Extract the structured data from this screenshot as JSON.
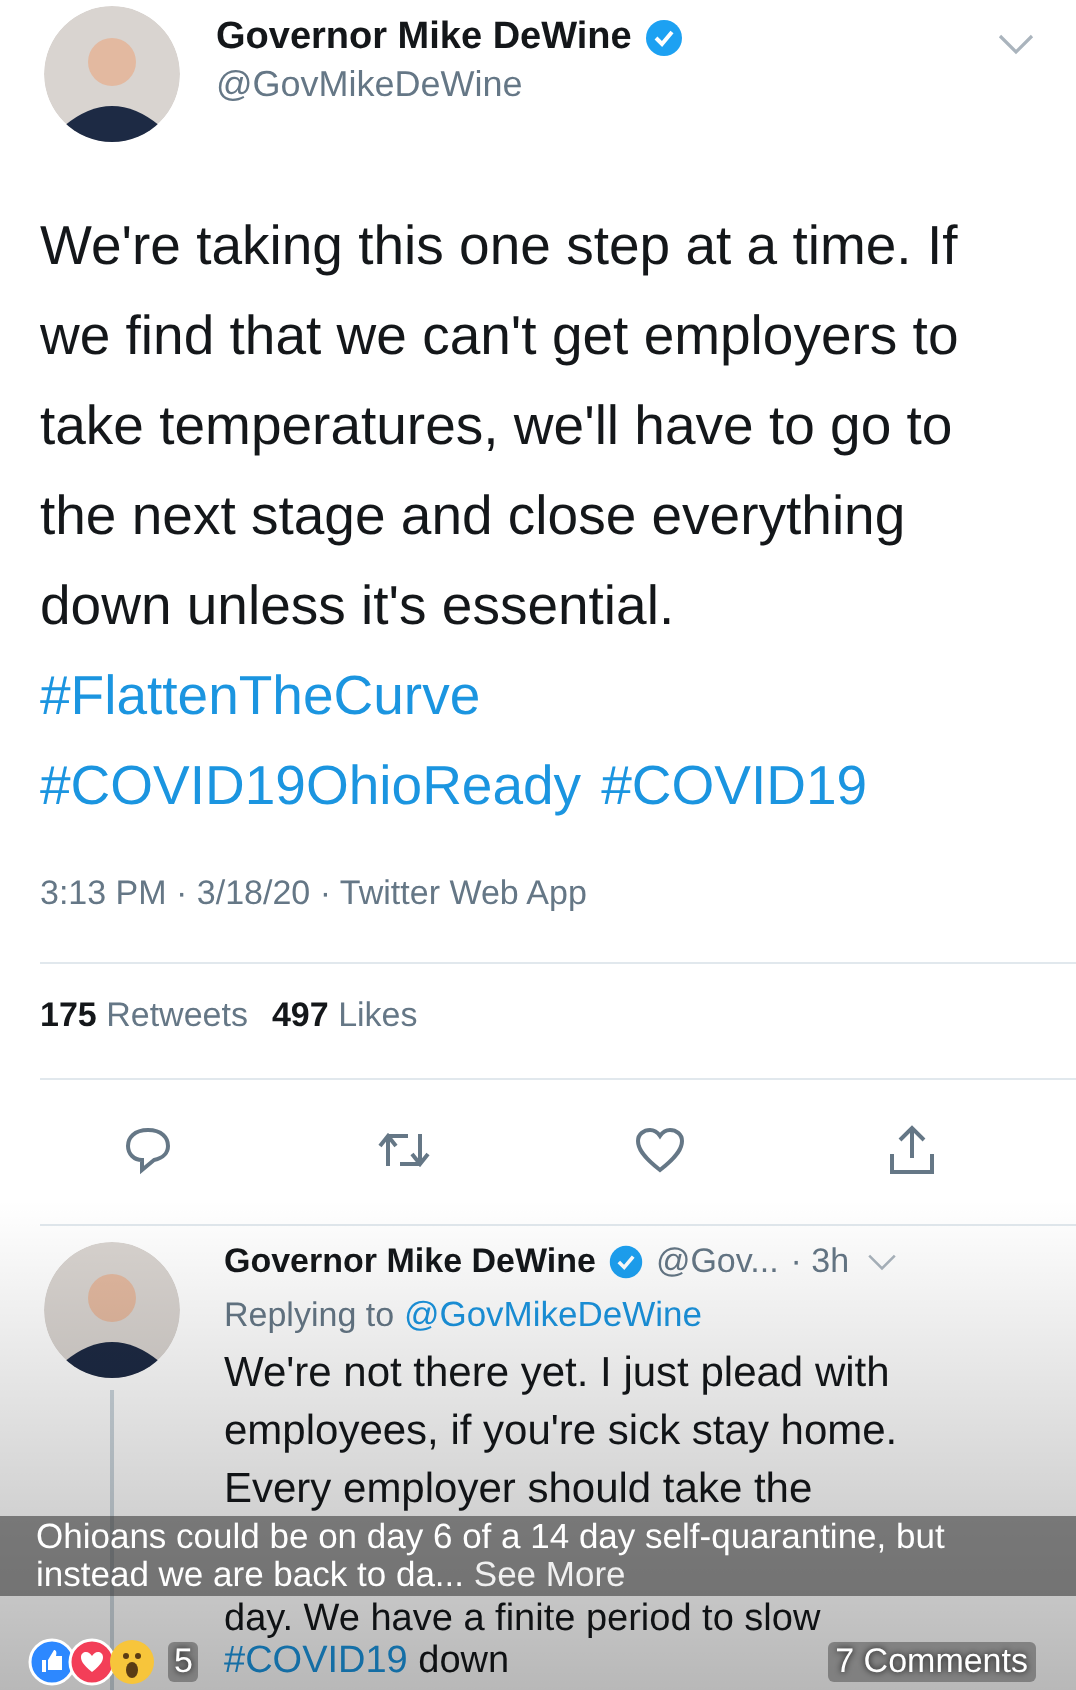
{
  "tweet": {
    "name": "Governor Mike DeWine",
    "verified": true,
    "handle": "@GovMikeDeWine",
    "text": "We're taking this one step at a time. If we find that we can't get employers to take temperatures, we'll have to go to the next stage and close everything down unless it's essential.",
    "hashtags": [
      "#FlattenTheCurve",
      "#COVID19OhioReady",
      "#COVID19"
    ],
    "meta": "3:13 PM · 3/18/20 · Twitter Web App",
    "stats": [
      {
        "count": "175",
        "label": "Retweets"
      },
      {
        "count": "497",
        "label": "Likes"
      }
    ]
  },
  "reply": {
    "name": "Governor Mike DeWine",
    "verified": true,
    "handle": "@Gov...",
    "time": "· 3h",
    "replying_label": "Replying to",
    "replying_handle": "@GovMikeDeWine",
    "text": "We're not there yet. I just plead with employees, if you're sick stay home. Every employer should take the",
    "text_after_caption": "day. We have a finite period to slow",
    "hashtag": "#COVID19",
    "after": "down"
  },
  "post": {
    "caption": "Ohioans could be on day 6 of a 14 day self-quarantine, but instead we are back to da...",
    "see_more": "See More",
    "reaction_count": "5",
    "comments": "7 Comments"
  }
}
